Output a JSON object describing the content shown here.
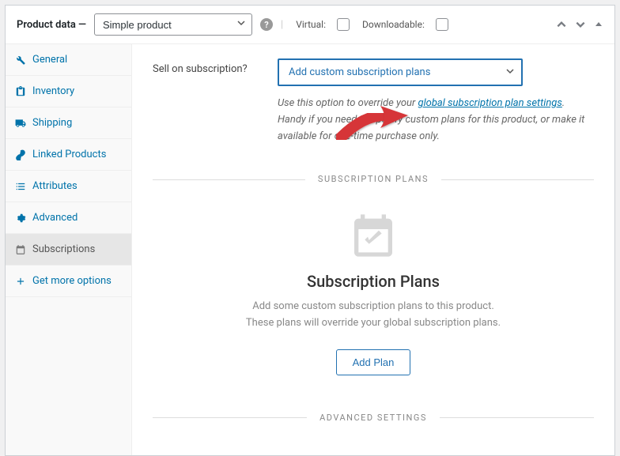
{
  "header": {
    "title": "Product data —",
    "productTypeSelected": "Simple product",
    "virtualLabel": "Virtual:",
    "downloadableLabel": "Downloadable:"
  },
  "sidebar": {
    "tabs": [
      {
        "label": "General"
      },
      {
        "label": "Inventory"
      },
      {
        "label": "Shipping"
      },
      {
        "label": "Linked Products"
      },
      {
        "label": "Attributes"
      },
      {
        "label": "Advanced"
      },
      {
        "label": "Subscriptions"
      },
      {
        "label": "Get more options"
      }
    ]
  },
  "content": {
    "fieldLabel": "Sell on subscription?",
    "dropdownValue": "Add custom subscription plans",
    "helpPrefix": "Use this option to override your ",
    "helpLink": "global subscription plan settings",
    "helpSuffix": ". Handy if you need to specify custom plans for this product, or make it available for one-time purchase only.",
    "section1Title": "SUBSCRIPTION PLANS",
    "emptyTitle": "Subscription Plans",
    "emptyLine1": "Add some custom subscription plans to this product.",
    "emptyLine2": "These plans will override your global subscription plans.",
    "addPlanLabel": "Add Plan",
    "section2Title": "ADVANCED SETTINGS"
  }
}
